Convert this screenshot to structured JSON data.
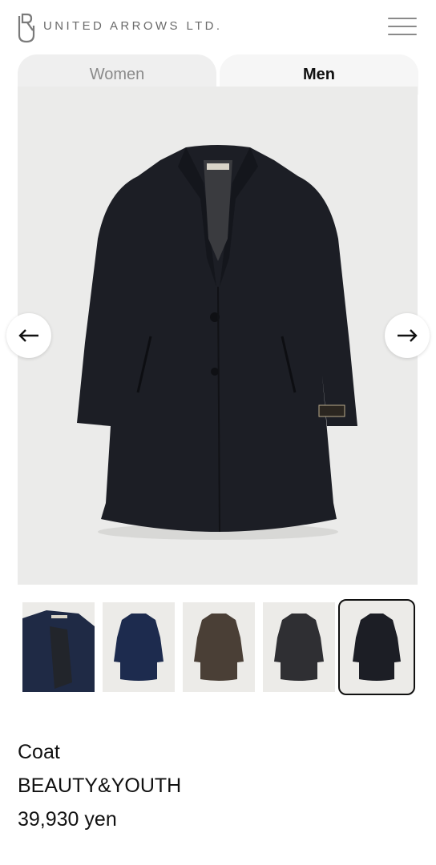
{
  "header": {
    "brand": "UNITED ARROWS LTD.",
    "logo_icon": "ua-logo-icon",
    "menu_icon": "hamburger-menu-icon"
  },
  "tabs": [
    {
      "label": "Women",
      "active": false
    },
    {
      "label": "Men",
      "active": true
    }
  ],
  "gallery": {
    "prev_icon": "arrow-left-icon",
    "next_icon": "arrow-right-icon",
    "thumbnails": [
      {
        "color": "#1f2a45",
        "variant": "detail"
      },
      {
        "color": "#1d2b4e",
        "variant": "coat"
      },
      {
        "color": "#4a3f36",
        "variant": "coat"
      },
      {
        "color": "#2f2f33",
        "variant": "coat"
      },
      {
        "color": "#1c1e25",
        "variant": "coat",
        "selected": true
      }
    ]
  },
  "product": {
    "name": "Coat",
    "brand": "BEAUTY&YOUTH",
    "price": "39,930 yen"
  }
}
